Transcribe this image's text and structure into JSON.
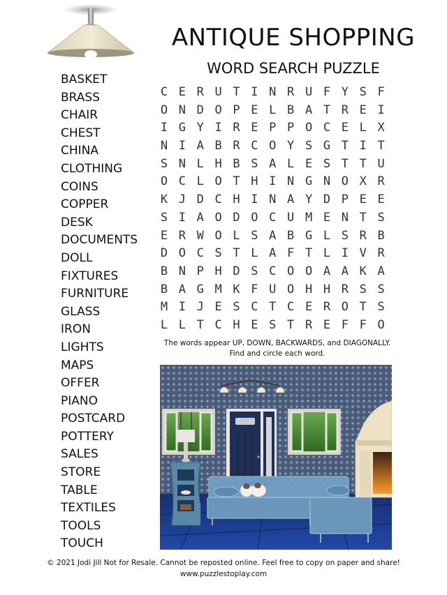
{
  "header": {
    "title": "ANTIQUE SHOPPING",
    "subtitle": "WORD SEARCH PUZZLE"
  },
  "word_list": [
    "BASKET",
    "BRASS",
    "CHAIR",
    "CHEST",
    "CHINA",
    "CLOTHING",
    "COINS",
    "COPPER",
    "DESK",
    "DOCUMENTS",
    "DOLL",
    "FIXTURES",
    "FURNITURE",
    "GLASS",
    "IRON",
    "LIGHTS",
    "MAPS",
    "OFFER",
    "PIANO",
    "POSTCARD",
    "POTTERY",
    "SALES",
    "STORE",
    "TABLE",
    "TEXTILES",
    "TOOLS",
    "TOUCH"
  ],
  "grid": [
    [
      "C",
      "E",
      "R",
      "U",
      "T",
      "I",
      "N",
      "R",
      "U",
      "F",
      "Y",
      "S",
      "F"
    ],
    [
      "O",
      "N",
      "D",
      "O",
      "P",
      "E",
      "L",
      "B",
      "A",
      "T",
      "R",
      "E",
      "I"
    ],
    [
      "I",
      "G",
      "Y",
      "I",
      "R",
      "E",
      "P",
      "P",
      "O",
      "C",
      "E",
      "L",
      "X"
    ],
    [
      "N",
      "I",
      "A",
      "B",
      "R",
      "C",
      "O",
      "Y",
      "S",
      "G",
      "T",
      "I",
      "T"
    ],
    [
      "S",
      "N",
      "L",
      "H",
      "B",
      "S",
      "A",
      "L",
      "E",
      "S",
      "T",
      "T",
      "U"
    ],
    [
      "O",
      "C",
      "L",
      "O",
      "T",
      "H",
      "I",
      "N",
      "G",
      "N",
      "O",
      "X",
      "R"
    ],
    [
      "K",
      "J",
      "D",
      "C",
      "H",
      "I",
      "N",
      "A",
      "Y",
      "D",
      "P",
      "E",
      "E"
    ],
    [
      "S",
      "I",
      "A",
      "O",
      "D",
      "O",
      "C",
      "U",
      "M",
      "E",
      "N",
      "T",
      "S"
    ],
    [
      "E",
      "R",
      "W",
      "O",
      "L",
      "S",
      "A",
      "B",
      "G",
      "L",
      "S",
      "R",
      "B"
    ],
    [
      "D",
      "O",
      "C",
      "S",
      "T",
      "L",
      "A",
      "F",
      "T",
      "L",
      "I",
      "V",
      "R"
    ],
    [
      "B",
      "N",
      "P",
      "H",
      "D",
      "S",
      "C",
      "O",
      "O",
      "A",
      "A",
      "K",
      "A"
    ],
    [
      "B",
      "A",
      "G",
      "M",
      "K",
      "F",
      "U",
      "O",
      "H",
      "H",
      "R",
      "S",
      "S"
    ],
    [
      "M",
      "I",
      "J",
      "E",
      "S",
      "C",
      "T",
      "C",
      "E",
      "R",
      "O",
      "T",
      "S"
    ],
    [
      "L",
      "L",
      "T",
      "C",
      "H",
      "E",
      "S",
      "T",
      "R",
      "E",
      "F",
      "F",
      "O"
    ]
  ],
  "instructions": {
    "line1": "The words appear UP, DOWN, BACKWARDS, and DIAGONALLY.",
    "line2": "Find and circle each word."
  },
  "illustration": {
    "description": "Blue living room with sectional sofa, two cats, front door, two open windows, track lights, fireplace, side table and lamp",
    "wall_color": "#4a5d7a",
    "floor_color": "#1c3a8a",
    "sofa_color": "#6f9cc0",
    "door_color": "#1f2f55"
  },
  "lamp": {
    "icon": "ceiling-lamp-icon",
    "shade_color": "#e7e0c8"
  },
  "footer": {
    "copyright": "© 2021  Jodi Jill Not for Resale. Cannot be reposted online. Feel free to copy on paper and share!",
    "website": "www.puzzlestoplay.com"
  }
}
